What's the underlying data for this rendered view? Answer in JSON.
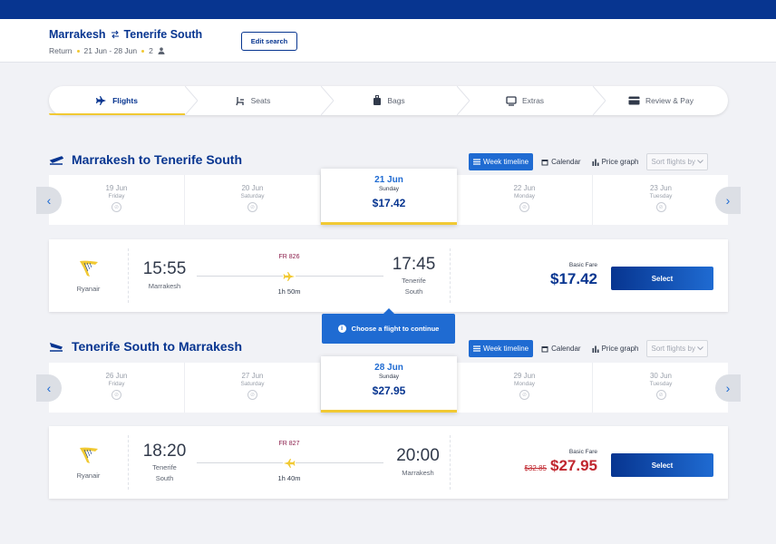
{
  "header": {
    "origin": "Marrakesh",
    "destination": "Tenerife South",
    "trip_type": "Return",
    "dates": "21 Jun - 28 Jun",
    "passengers": "2",
    "edit_label": "Edit search"
  },
  "steps": [
    {
      "label": "Flights",
      "icon": "plane-icon",
      "active": true
    },
    {
      "label": "Seats",
      "icon": "seat-icon",
      "active": false
    },
    {
      "label": "Bags",
      "icon": "bag-icon",
      "active": false
    },
    {
      "label": "Extras",
      "icon": "extras-icon",
      "active": false
    },
    {
      "label": "Review & Pay",
      "icon": "card-icon",
      "active": false
    }
  ],
  "tools": {
    "week": "Week timeline",
    "calendar": "Calendar",
    "graph": "Price graph",
    "sort": "Sort flights by"
  },
  "outbound": {
    "title": "Marrakesh to Tenerife South",
    "dates": [
      {
        "date": "19 Jun",
        "weekday": "Friday",
        "price": null
      },
      {
        "date": "20 Jun",
        "weekday": "Saturday",
        "price": null
      },
      {
        "date": "21 Jun",
        "weekday": "Sunday",
        "price": "$17.42"
      },
      {
        "date": "22 Jun",
        "weekday": "Monday",
        "price": null
      },
      {
        "date": "23 Jun",
        "weekday": "Tuesday",
        "price": null
      }
    ],
    "flight": {
      "airline": "Ryanair",
      "depart_time": "15:55",
      "depart_place": "Marrakesh",
      "flight_number": "FR 826",
      "duration": "1h 50m",
      "arrive_time": "17:45",
      "arrive_place_1": "Tenerife",
      "arrive_place_2": "South",
      "fare_label": "Basic Fare",
      "price": "$17.42",
      "select_label": "Select"
    }
  },
  "tooltip": "Choose a flight to continue",
  "inbound": {
    "title": "Tenerife South to Marrakesh",
    "dates": [
      {
        "date": "26 Jun",
        "weekday": "Friday",
        "price": null
      },
      {
        "date": "27 Jun",
        "weekday": "Saturday",
        "price": null
      },
      {
        "date": "28 Jun",
        "weekday": "Sunday",
        "price": "$27.95"
      },
      {
        "date": "29 Jun",
        "weekday": "Monday",
        "price": null
      },
      {
        "date": "30 Jun",
        "weekday": "Tuesday",
        "price": null
      }
    ],
    "flight": {
      "airline": "Ryanair",
      "depart_time": "18:20",
      "depart_place_1": "Tenerife",
      "depart_place_2": "South",
      "flight_number": "FR 827",
      "duration": "1h 40m",
      "arrive_time": "20:00",
      "arrive_place": "Marrakesh",
      "fare_label": "Basic Fare",
      "old_price": "$32.85",
      "price": "$27.95",
      "select_label": "Select"
    }
  },
  "colors": {
    "brand_blue": "#073590",
    "accent_blue": "#1f6bd2",
    "yellow": "#f1c933",
    "sale_red": "#c0262e"
  }
}
